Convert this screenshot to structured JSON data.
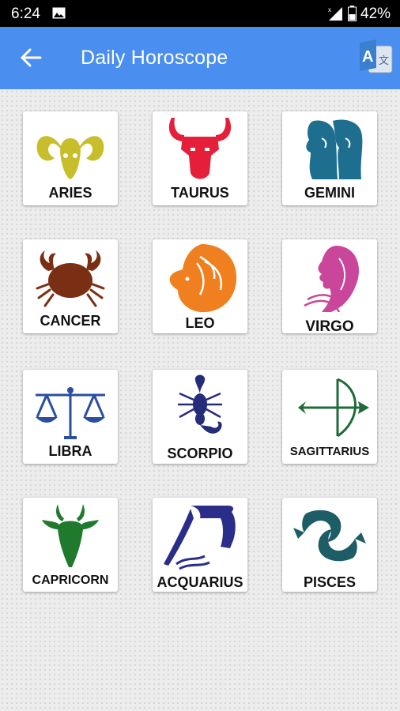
{
  "status_bar": {
    "time": "6:24",
    "battery": "42%"
  },
  "app_bar": {
    "title": "Daily Horoscope"
  },
  "signs": [
    {
      "label": "ARIES",
      "color": "#c8bd2a"
    },
    {
      "label": "TAURUS",
      "color": "#e51f3a"
    },
    {
      "label": "GEMINI",
      "color": "#1e6f8f"
    },
    {
      "label": "CANCER",
      "color": "#7a2f14"
    },
    {
      "label": "LEO",
      "color": "#f07f1f"
    },
    {
      "label": "VIRGO",
      "color": "#c9469a"
    },
    {
      "label": "LIBRA",
      "color": "#2a4ea0"
    },
    {
      "label": "SCORPIO",
      "color": "#252c7a"
    },
    {
      "label": "SAGITTARIUS",
      "color": "#1f6b3a"
    },
    {
      "label": "CAPRICORN",
      "color": "#1f7a2e"
    },
    {
      "label": "ACQUARIUS",
      "color": "#2a2e8a"
    },
    {
      "label": "PISCES",
      "color": "#1d5d66"
    }
  ]
}
